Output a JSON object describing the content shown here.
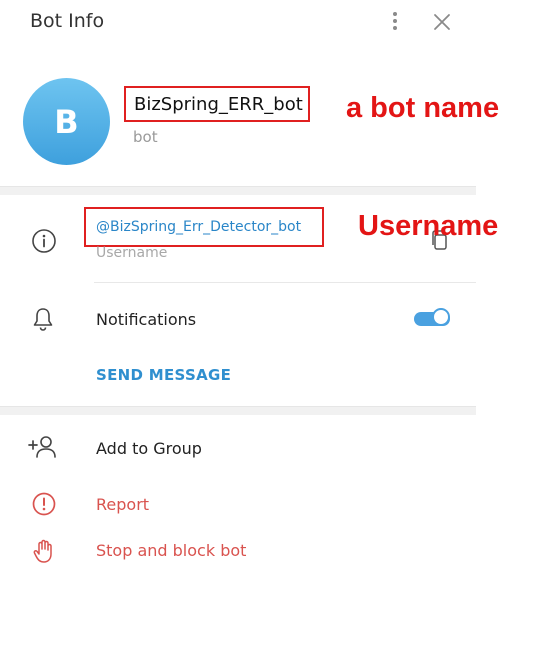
{
  "header": {
    "title": "Bot Info"
  },
  "profile": {
    "avatar_letter": "B",
    "name": "BizSpring_ERR_bot",
    "subtitle": "bot",
    "avatar_gradient": [
      "#6ec4f0",
      "#3ea0dd"
    ]
  },
  "annotations": {
    "bot_name": "a bot name",
    "username": "Username",
    "color": "#e31515"
  },
  "info": {
    "username_value": "@BizSpring_Err_Detector_bot",
    "username_label": "Username"
  },
  "notifications": {
    "label": "Notifications",
    "enabled": true
  },
  "actions": {
    "send_message": "SEND MESSAGE",
    "add_to_group": "Add to Group",
    "report": "Report",
    "stop_block": "Stop and block bot"
  },
  "colors": {
    "accent": "#2f8fcf",
    "danger": "#d9534f",
    "toggle": "#4aa1e0"
  },
  "icons": [
    "more-vertical-icon",
    "close-icon",
    "info-icon",
    "copy-icon",
    "bell-icon",
    "toggle-switch",
    "add-user-icon",
    "report-icon",
    "hand-stop-icon"
  ]
}
